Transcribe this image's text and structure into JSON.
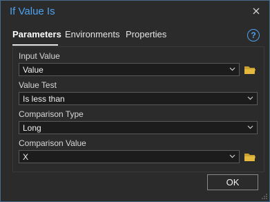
{
  "dialog": {
    "title": "If Value Is"
  },
  "tabs": [
    {
      "label": "Parameters",
      "active": true
    },
    {
      "label": "Environments",
      "active": false
    },
    {
      "label": "Properties",
      "active": false
    }
  ],
  "help": {
    "glyph": "?"
  },
  "params": {
    "input_value": {
      "label": "Input Value",
      "value": "Value"
    },
    "value_test": {
      "label": "Value Test",
      "value": "Is less than"
    },
    "comparison_type": {
      "label": "Comparison Type",
      "value": "Long"
    },
    "comparison_value": {
      "label": "Comparison Value",
      "value": "X"
    }
  },
  "ok_label": "OK",
  "colors": {
    "accent": "#4da3f2",
    "folder": "#e5b93e"
  }
}
